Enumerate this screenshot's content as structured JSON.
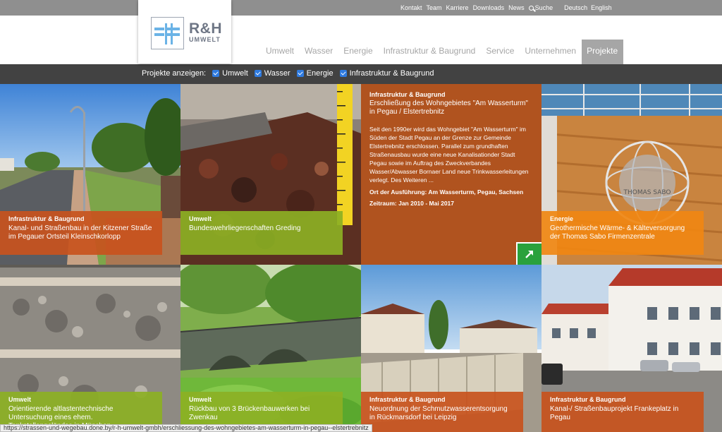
{
  "topnav": {
    "links": [
      "Kontakt",
      "Team",
      "Karriere",
      "Downloads",
      "News"
    ],
    "search_label": "Suche",
    "languages": [
      "Deutsch",
      "English"
    ]
  },
  "logo": {
    "title": "R&H",
    "subtitle": "UMWELT"
  },
  "mainnav": {
    "items": [
      "Umwelt",
      "Wasser",
      "Energie",
      "Infrastruktur & Baugrund",
      "Service",
      "Unternehmen",
      "Projekte"
    ],
    "active": "Projekte"
  },
  "filter": {
    "label": "Projekte anzeigen:",
    "options": [
      "Umwelt",
      "Wasser",
      "Energie",
      "Infrastruktur & Baugrund"
    ]
  },
  "projects": [
    {
      "category": "Infrastruktur & Baugrund",
      "title": "Kanal- und Straßenbau in der Kitzener Straße im Pegauer Ortsteil Kleinschkorlopp",
      "color": "#c8531d"
    },
    {
      "category": "Umwelt",
      "title": "Bundeswehrliegenschaften Greding",
      "color": "#8cb024"
    },
    {
      "category": "Energie",
      "title": "Geothermische Wärme- & Kälteversorgung der Thomas Sabo Firmenzentrale",
      "color": "#f08712"
    },
    {
      "category": "Umwelt",
      "title": "Orientierende altlastentechnische Untersuchung eines ehem. Tankstellengeländes in München",
      "color": "#8cb024"
    },
    {
      "category": "Umwelt",
      "title": "Rückbau von 3 Brückenbauwerken bei Zwenkau",
      "color": "#8cb024"
    },
    {
      "category": "Infrastruktur & Baugrund",
      "title": "Neuordnung der Schmutzwasserentsorgung in Rückmarsdorf bei Leipzig",
      "color": "#c8531d"
    },
    {
      "category": "Infrastruktur & Baugrund",
      "title": "Kanal-/ Straßenbauprojekt Frankeplatz in Pegau",
      "color": "#c8531d"
    }
  ],
  "detail": {
    "category": "Infrastruktur & Baugrund",
    "title": "Erschließung des Wohngebietes \"Am Wasserturm\" in Pegau / Elstertrebnitz",
    "description": "Seit den 1990er wird das Wohngebiet \"Am Wasserturm\" im Süden der Stadt Pegau an der Grenze zur Gemeinde Elstertrebnitz erschlossen. Parallel zum grundhaften Straßenausbau wurde eine neue Kanalisationder Stadt Pegau sowie im Auftrag des Zweckverbandes Wasser/Abwasser Bornaer Land neue Trinkwasserleitungen verlegt. Des Weiteren ...",
    "location": "Ort der Ausführung: Am Wasserturm, Pegau, Sachsen",
    "period": "Zeitraum: Jan 2010 - Mai 2017"
  },
  "photo_texts": {
    "globe_lettering": "THOMAS SABO"
  },
  "status_url": "https://strassen-und-wegebau.done.by/r-h-umwelt-gmbh/erschliessung-des-wohngebietes-am-wasserturm-in-pegau--elstertrebnitz",
  "icons": {
    "search": "search-icon",
    "open": "arrow-external-icon"
  }
}
